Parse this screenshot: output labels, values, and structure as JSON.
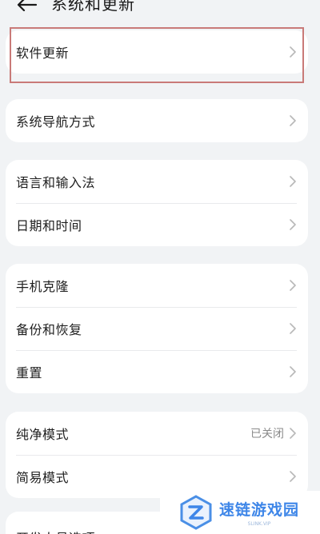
{
  "header": {
    "title": "系统和更新"
  },
  "groups": [
    {
      "items": [
        {
          "label": "软件更新"
        }
      ]
    },
    {
      "items": [
        {
          "label": "系统导航方式"
        }
      ]
    },
    {
      "items": [
        {
          "label": "语言和输入法"
        },
        {
          "label": "日期和时间"
        }
      ]
    },
    {
      "items": [
        {
          "label": "手机克隆"
        },
        {
          "label": "备份和恢复"
        },
        {
          "label": "重置"
        }
      ]
    },
    {
      "items": [
        {
          "label": "纯净模式",
          "value": "已关闭"
        },
        {
          "label": "简易模式"
        }
      ]
    },
    {
      "items": [
        {
          "label": "开发人员选项"
        }
      ]
    }
  ],
  "watermark": {
    "name": "速链游戏园",
    "url": "SLINK.VIP"
  },
  "colors": {
    "background": "#f1f3f5",
    "card": "#ffffff",
    "highlight_border": "#c97a78",
    "watermark_accent": "#3e86e8"
  }
}
